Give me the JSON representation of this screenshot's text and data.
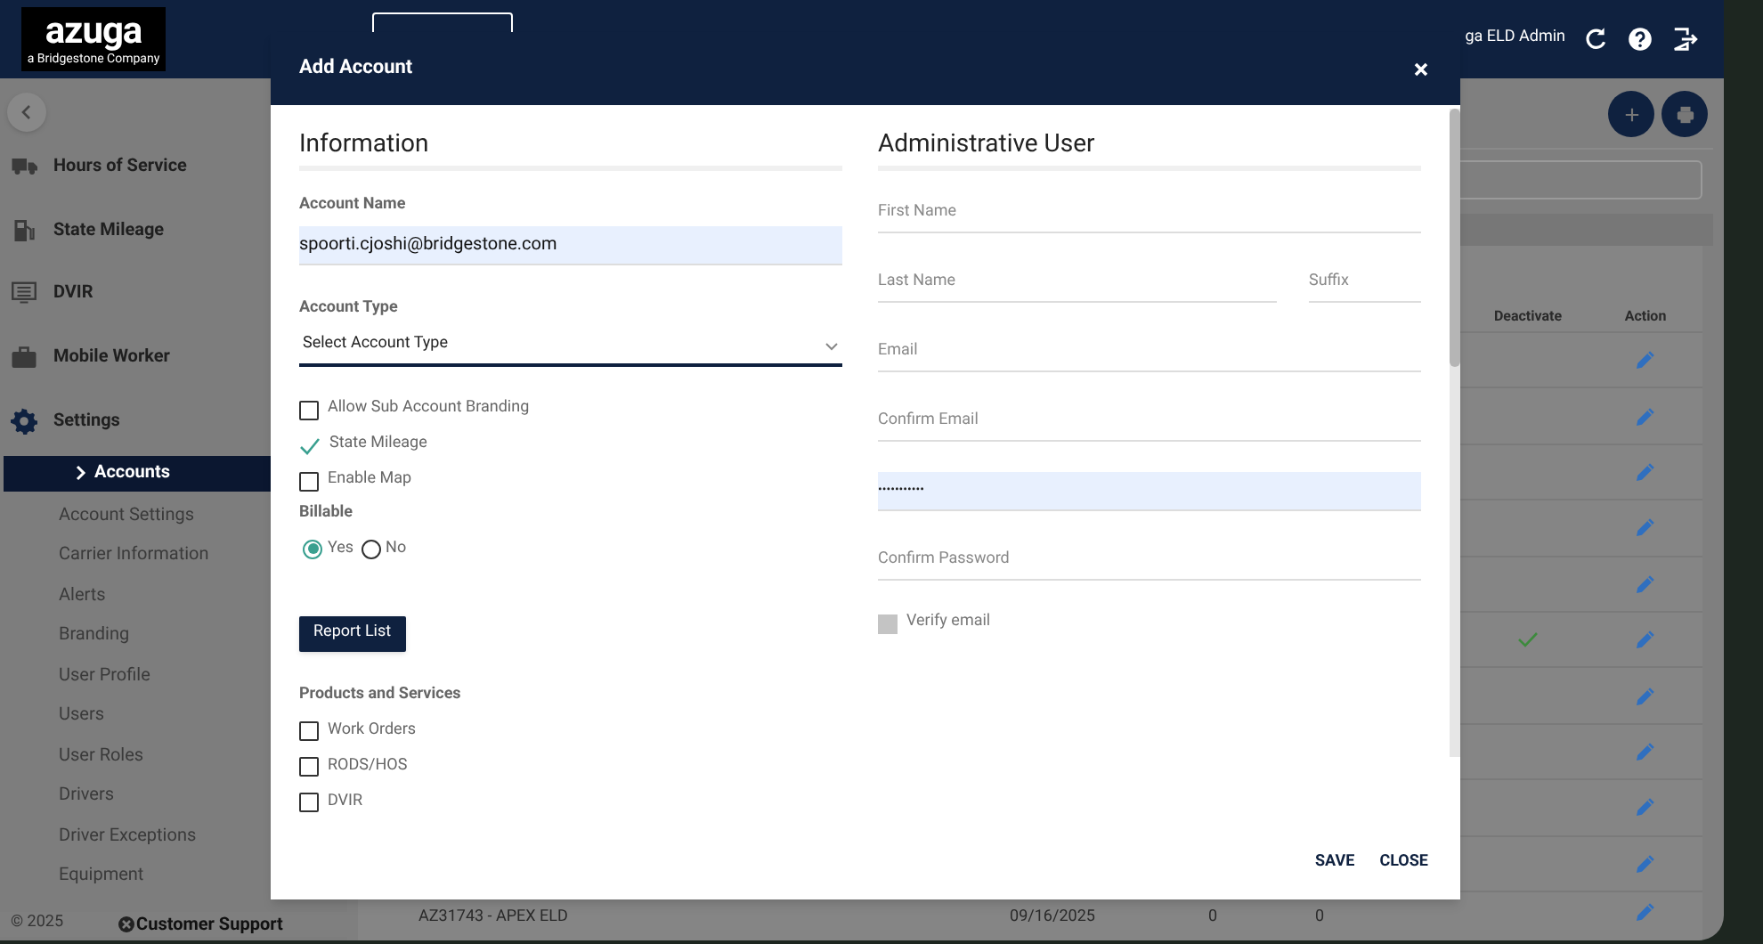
{
  "topbar": {
    "logo": "azuga",
    "logo_tag": "a Bridgestone Company",
    "user": "ga ELD Admin"
  },
  "sidebar": {
    "nav": [
      {
        "label": "Hours of Service"
      },
      {
        "label": "State Mileage"
      },
      {
        "label": "DVIR"
      },
      {
        "label": "Mobile Worker"
      },
      {
        "label": "Settings"
      }
    ],
    "settings_items": [
      {
        "label": "Accounts",
        "selected": true
      },
      {
        "label": "Account Settings",
        "selected": false
      },
      {
        "label": "Carrier Information",
        "selected": false
      },
      {
        "label": "Alerts",
        "selected": false
      },
      {
        "label": "Branding",
        "selected": false
      },
      {
        "label": "User Profile",
        "selected": false
      },
      {
        "label": "Users",
        "selected": false
      },
      {
        "label": "User Roles",
        "selected": false
      },
      {
        "label": "Drivers",
        "selected": false
      },
      {
        "label": "Driver Exceptions",
        "selected": false
      },
      {
        "label": "Equipment",
        "selected": false
      }
    ],
    "copyright": "© 2025",
    "support": "Customer Support"
  },
  "table": {
    "columns": [
      "Deactivate",
      "Action"
    ],
    "rows": [
      {
        "deactivated": false
      },
      {
        "deactivated": false
      },
      {
        "deactivated": false
      },
      {
        "deactivated": false
      },
      {
        "deactivated": false
      },
      {
        "deactivated": true
      },
      {
        "deactivated": false
      },
      {
        "deactivated": false
      },
      {
        "deactivated": false
      },
      {
        "deactivated": false
      }
    ],
    "last_row": [
      "AZ31743 - APEX ELD",
      "09/16/2025",
      "0",
      "0"
    ]
  },
  "modal": {
    "title": "Add Account",
    "information": {
      "title": "Information",
      "account_name": {
        "label": "Account Name",
        "value": "spoorti.cjoshi@bridgestone.com"
      },
      "account_type": {
        "label": "Account Type",
        "placeholder": "Select Account Type"
      },
      "options": [
        {
          "label": "Allow Sub Account Branding",
          "checked": false
        },
        {
          "label": "State Mileage",
          "checked": true
        },
        {
          "label": "Enable Map",
          "checked": false
        }
      ],
      "billable": {
        "label": "Billable",
        "options": [
          {
            "label": "Yes",
            "selected": true
          },
          {
            "label": "No",
            "selected": false
          }
        ]
      },
      "report_button": "Report List",
      "products": {
        "title": "Products and Services",
        "items": [
          {
            "label": "Work Orders",
            "checked": false
          },
          {
            "label": "RODS/HOS",
            "checked": false
          },
          {
            "label": "DVIR",
            "checked": false
          }
        ]
      }
    },
    "admin": {
      "title": "Administrative User",
      "rows": [
        [
          {
            "placeholder": "First Name"
          }
        ],
        [
          {
            "placeholder": "Last Name"
          },
          {
            "placeholder": "Suffix"
          }
        ],
        [
          {
            "placeholder": "Email"
          }
        ],
        [
          {
            "placeholder": "Confirm Email"
          }
        ],
        [
          {
            "value": "•••••••••••"
          }
        ],
        [
          {
            "placeholder": "Confirm Password"
          }
        ]
      ],
      "verify": {
        "label": "Verify email",
        "checked": false,
        "disabled": true
      }
    },
    "buttons": [
      "SAVE",
      "CLOSE"
    ]
  }
}
